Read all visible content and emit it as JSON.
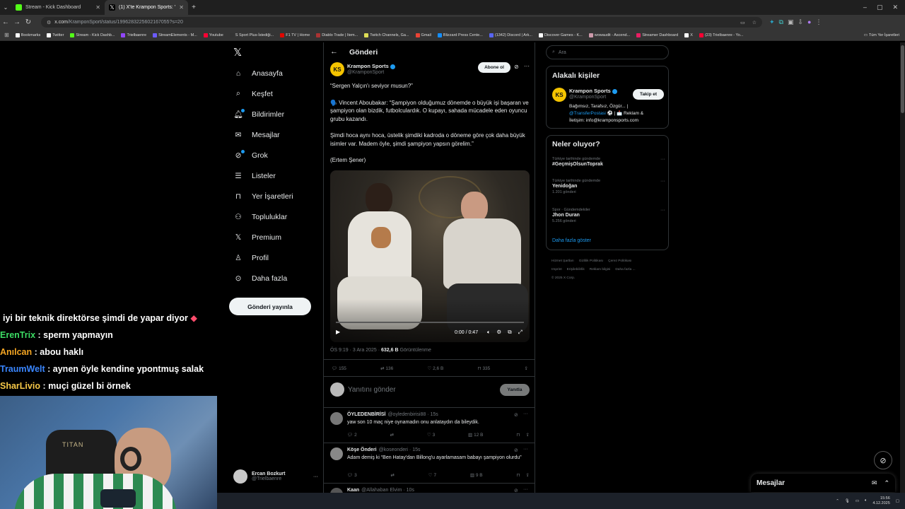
{
  "browser": {
    "tabs": [
      {
        "title": "Stream - Kick Dashboard",
        "color": "#53fc18"
      },
      {
        "title": "(1) X'te Krampon Sports: \"Serg",
        "color": "#ffffff"
      }
    ],
    "url_host": "x.com",
    "url_path": "/KramponSport/status/1996283225602167055?s=20",
    "bookmarks": [
      {
        "label": "Bookmarks",
        "color": "#ffffff"
      },
      {
        "label": "Twitter",
        "color": "#ffffff"
      },
      {
        "label": "Stream - Kick Dashb...",
        "color": "#53fc18"
      },
      {
        "label": "Trielbaenre",
        "color": "#9146ff"
      },
      {
        "label": "StreamElements - M...",
        "color": "#6b5bff"
      },
      {
        "label": "Youtube",
        "color": "#ff0033"
      },
      {
        "label": "S Sport Plus-İstediği...",
        "color": "#333333"
      },
      {
        "label": "F1 TV | Home",
        "color": "#e10600"
      },
      {
        "label": "Diablo Trade | Item...",
        "color": "#a33"
      },
      {
        "label": "Twitch Channels, Ga...",
        "color": "#dddd55"
      },
      {
        "label": "Gmail",
        "color": "#ea4335"
      },
      {
        "label": "Blizzard Press Cente...",
        "color": "#148eff"
      },
      {
        "label": "(1342) Discord | Ark...",
        "color": "#5865f2"
      },
      {
        "label": "Discover Games - K...",
        "color": "#ffffff"
      },
      {
        "label": "wowaudit - Ascend...",
        "color": "#c9a"
      },
      {
        "label": "Streamer Dashboard",
        "color": "#e91e63"
      },
      {
        "label": "X",
        "color": "#ffffff"
      },
      {
        "label": "(23) Trielbaenre - Yo...",
        "color": "#ff0033"
      }
    ],
    "all_bookmarks": "Tüm Yer İşaretleri"
  },
  "chat": [
    {
      "user": "",
      "message": "iyi bir teknik direktörse şimdi de yapar diyor",
      "color": "#ffffff"
    },
    {
      "user": "ErenTrix",
      "message": "sperm yapmayın",
      "color": "#3cdc64"
    },
    {
      "user": "Anılcan",
      "message": "abou haklı",
      "color": "#f5a623"
    },
    {
      "user": "TraumWelt",
      "message": "aynen öyle kendine ypontmuş salak",
      "color": "#3a86ff"
    },
    {
      "user": "SharLivio",
      "message": "muçi güzel bi örnek",
      "color": "#f7c948"
    }
  ],
  "webcam": {
    "chair_brand": "TITAN"
  },
  "nav": {
    "items": [
      {
        "label": "Anasayfa",
        "icon": "home-icon"
      },
      {
        "label": "Keşfet",
        "icon": "search-icon"
      },
      {
        "label": "Bildirimler",
        "icon": "bell-icon"
      },
      {
        "label": "Mesajlar",
        "icon": "mail-icon"
      },
      {
        "label": "Grok",
        "icon": "grok-icon"
      },
      {
        "label": "Listeler",
        "icon": "list-icon"
      },
      {
        "label": "Yer İşaretleri",
        "icon": "bookmark-icon"
      },
      {
        "label": "Topluluklar",
        "icon": "people-icon"
      },
      {
        "label": "Premium",
        "icon": "x-logo-icon"
      },
      {
        "label": "Profil",
        "icon": "person-icon"
      },
      {
        "label": "Daha fazla",
        "icon": "more-circle-icon"
      }
    ],
    "post_button": "Gönderi yayınla",
    "profile": {
      "name": "Ercan Bozkurt",
      "handle": "@Trielbaenre"
    }
  },
  "main": {
    "header": "Gönderi",
    "tweet": {
      "author": "Krampon Sports",
      "handle": "@KramponSport",
      "follow_label": "Abone ol",
      "avatar_text": "KS",
      "para1": "“Sergen Yalçın'ı seviyor musun?”",
      "para2": "🗣️ Vincent Aboubakar: “Şampiyon olduğumuz dönemde o büyük işi başaran ve şampiyon olan bizdik, futbolculardık. O kupayı, sahada mücadele eden oyuncu grubu kazandı.",
      "para3": "Şimdi hoca aynı hoca, üstelik şimdiki kadroda o döneme göre çok daha büyük isimler var. Madem öyle, şimdi şampiyon yapsın görelim.”",
      "para4": "(Ertem Şener)",
      "video_time": "0:00 / 0:47",
      "video_progress": 0.0,
      "timestamp": "ÖS 9:19 · 3 Ara 2025 · ",
      "views": "632,6 B",
      "views_label": " Görüntülenme",
      "replies": "155",
      "reposts": "136",
      "likes": "2,6 B",
      "bookmarks": "335"
    },
    "compose": {
      "placeholder": "Yanıtını gönder",
      "button": "Yanıtla"
    },
    "replies": [
      {
        "name": "ÖYLEDENBİRİSİ",
        "handle": "@oyledenbirisi88 · 15s",
        "text": "yaw son 10 maç niye oynamadın onu anlataydın da bileydik.",
        "replies": "2",
        "reposts": "",
        "likes": "3",
        "views": "12 B",
        "avatar": "#777777"
      },
      {
        "name": "Köşe Önderi",
        "handle": "@koseonderi · 15s",
        "text": "Adam demiş ki “Ben Hatay'dan Billong'u ayarlamasam babayı şampiyon olurdu”",
        "replies": "3",
        "reposts": "",
        "likes": "7",
        "views": "9 B",
        "avatar": "#888888"
      },
      {
        "name": "Kaan",
        "handle": "@Allahaban Elvim · 10s",
        "text": "",
        "replies": "",
        "reposts": "",
        "likes": "",
        "views": "",
        "avatar": "#555555"
      }
    ]
  },
  "right": {
    "search_placeholder": "Ara",
    "related": {
      "title": "Alakalı kişiler",
      "name": "Krampon Sports",
      "handle": "@KramponSport",
      "follow": "Takip et",
      "bio1": "Bağımsız, Tarafsız, Özgür... |",
      "bio_link": "@TransferPostasi",
      "bio2": " ⚽ | 📩 Reklam &",
      "bio3": "İletişim: info@kramponsports.com"
    },
    "trends": {
      "title": "Neler oluyor?",
      "items": [
        {
          "meta": "Türkiye tarihinde gündemde",
          "name": "#GeçmişOlsunToprak",
          "count": ""
        },
        {
          "meta": "Türkiye tarihinde gündemde",
          "name": "Yenidoğan",
          "count": "1.201 gönderi"
        },
        {
          "meta": "Spor · Gündemdekiler",
          "name": "Jhon Duran",
          "count": "5.256 gönderi"
        }
      ],
      "show_more": "Daha fazla göster"
    },
    "footer": [
      "Hizmet Şartları",
      "Gizlilik Politikası",
      "Çerez Politikası",
      "Imprint",
      "Erişilebilirlik",
      "Reklam bilgisi",
      "Daha fazla ...",
      "© 2025 X Corp."
    ]
  },
  "messages": {
    "label": "Mesajlar"
  },
  "taskbar": {
    "time": "15:56",
    "date": "4.12.2025"
  }
}
